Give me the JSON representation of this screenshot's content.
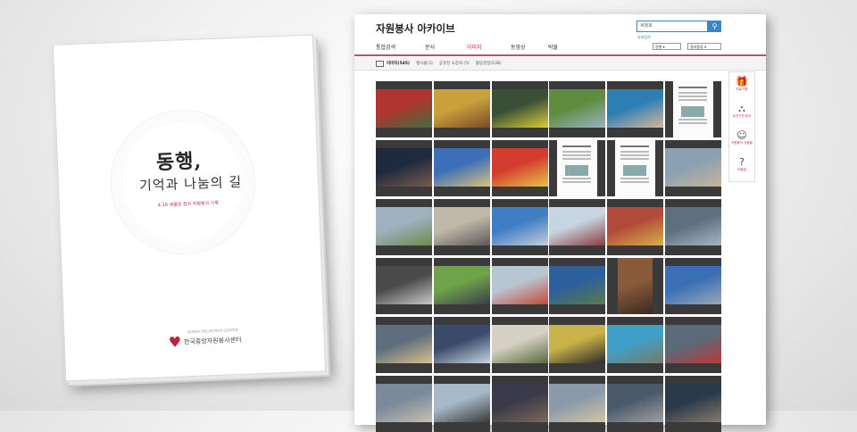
{
  "book": {
    "title_line1": "동행,",
    "title_line2": "기억과 나눔의 길",
    "subtitle": "4·16 세월호 참사 자원봉사 기록",
    "org_name": "한국중앙자원봉사센터",
    "org_small": "KOREA VOLUNTEER CENTER"
  },
  "archive": {
    "title": "자원봉사 아카이브",
    "search": {
      "value": "세월호",
      "button_icon": "search-icon"
    },
    "advanced_link": "상세검색",
    "tabs": [
      {
        "label": "통합검색",
        "active": false
      },
      {
        "label": "문서",
        "active": false
      },
      {
        "label": "이미지",
        "active": true
      },
      {
        "label": "동영상",
        "active": false
      },
      {
        "label": "박물",
        "active": false
      }
    ],
    "sort_select": "정렬",
    "view_select": "결과종류",
    "filters": [
      "이미지(545)",
      "행사물(3)",
      "공유된 소장처 (5)",
      "활동현장(538)"
    ],
    "accent_color": "#c7244a",
    "search_color": "#3a87c8"
  },
  "side_menu": [
    {
      "icon": "donation-icon",
      "label": "자료기증"
    },
    {
      "icon": "org-chart-icon",
      "label": "유관기관 링크"
    },
    {
      "icon": "volunteer-icon",
      "label": "자원봉사 사람들"
    },
    {
      "icon": "help-icon",
      "label": "도움말"
    }
  ],
  "thumbnails": [
    {
      "kind": "photo",
      "c1": "#b0342f",
      "c2": "#3e6f3a"
    },
    {
      "kind": "photo",
      "c1": "#c9a13a",
      "c2": "#7a4a2c"
    },
    {
      "kind": "photo",
      "c1": "#3a4f36",
      "c2": "#d6cf3a"
    },
    {
      "kind": "photo",
      "c1": "#5f8c3f",
      "c2": "#9bb2c7"
    },
    {
      "kind": "photo",
      "c1": "#2d7eb5",
      "c2": "#d7b89a"
    },
    {
      "kind": "doc",
      "c1": "#ffffff",
      "c2": "#ffffff"
    },
    {
      "kind": "photo",
      "c1": "#1d2a3f",
      "c2": "#7b5b4c"
    },
    {
      "kind": "photo",
      "c1": "#3c6fb8",
      "c2": "#d9c27a"
    },
    {
      "kind": "photo",
      "c1": "#d43c2f",
      "c2": "#e7c34a"
    },
    {
      "kind": "doc",
      "c1": "#ffffff",
      "c2": "#ffffff"
    },
    {
      "kind": "doc",
      "c1": "#ffffff",
      "c2": "#ffffff"
    },
    {
      "kind": "photo",
      "c1": "#8aa0b3",
      "c2": "#c8b49a"
    },
    {
      "kind": "photo",
      "c1": "#9fb0c0",
      "c2": "#6e8b4a"
    },
    {
      "kind": "photo",
      "c1": "#c0b8a8",
      "c2": "#5a5a5a"
    },
    {
      "kind": "photo",
      "c1": "#3f7ec4",
      "c2": "#c5cdd8"
    },
    {
      "kind": "photo",
      "c1": "#c7d5e2",
      "c2": "#8c3b3b"
    },
    {
      "kind": "photo",
      "c1": "#b04b3a",
      "c2": "#d7b04a"
    },
    {
      "kind": "photo",
      "c1": "#5f6f7f",
      "c2": "#a7b6c5"
    },
    {
      "kind": "photo",
      "c1": "#4a4a4a",
      "c2": "#c8c8c8"
    },
    {
      "kind": "photo",
      "c1": "#6ea34a",
      "c2": "#3a3f4a"
    },
    {
      "kind": "photo",
      "c1": "#b8c6d2",
      "c2": "#c24a3a"
    },
    {
      "kind": "photo",
      "c1": "#2c5f9c",
      "c2": "#5a7a4a"
    },
    {
      "kind": "portrait",
      "c1": "#8a5b3a",
      "c2": "#3a2a22"
    },
    {
      "kind": "photo",
      "c1": "#3a6fb5",
      "c2": "#9aa8b6"
    },
    {
      "kind": "photo",
      "c1": "#5e6e7e",
      "c2": "#d6c28a"
    },
    {
      "kind": "photo",
      "c1": "#3a4a6a",
      "c2": "#c8d4e0"
    },
    {
      "kind": "photo",
      "c1": "#d4d1c4",
      "c2": "#5a6a3a"
    },
    {
      "kind": "photo",
      "c1": "#c9b24a",
      "c2": "#2a2a2a"
    },
    {
      "kind": "photo",
      "c1": "#3ea0c9",
      "c2": "#7a7a6a"
    },
    {
      "kind": "photo",
      "c1": "#5a6a7a",
      "c2": "#b83a3a"
    },
    {
      "kind": "photo",
      "c1": "#7a8a9a",
      "c2": "#c8c0b0"
    },
    {
      "kind": "photo",
      "c1": "#a7b8c8",
      "c2": "#3a3a3a"
    },
    {
      "kind": "photo",
      "c1": "#3a3a4a",
      "c2": "#7a6a5a"
    },
    {
      "kind": "photo",
      "c1": "#8a9aaa",
      "c2": "#d4c4a4"
    },
    {
      "kind": "photo",
      "c1": "#4a5a6a",
      "c2": "#a0a0a0"
    },
    {
      "kind": "photo",
      "c1": "#2a3a4a",
      "c2": "#8a7a6a"
    }
  ]
}
